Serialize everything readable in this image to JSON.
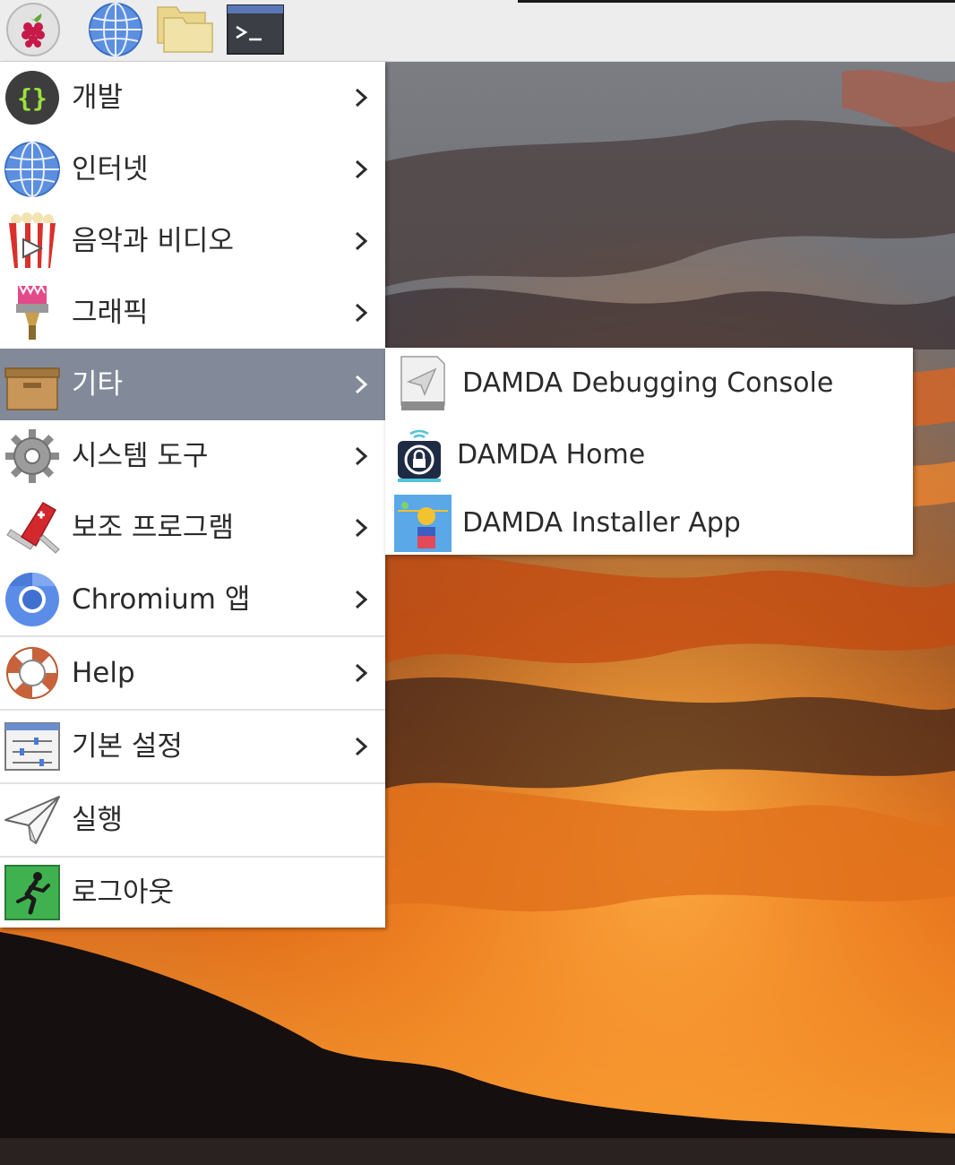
{
  "taskbar": {
    "buttons": [
      {
        "id": "menu",
        "icon": "raspberry-icon"
      },
      {
        "id": "web-browser",
        "icon": "globe-icon"
      },
      {
        "id": "file-manager",
        "icon": "folder-icon"
      },
      {
        "id": "terminal",
        "icon": "terminal-icon",
        "glyph": ">_"
      }
    ]
  },
  "menu": {
    "items": [
      {
        "label": "개발",
        "icon": "braces-icon",
        "has_submenu": true
      },
      {
        "label": "인터넷",
        "icon": "globe-icon",
        "has_submenu": true
      },
      {
        "label": "음악과 비디오",
        "icon": "popcorn-icon",
        "has_submenu": true
      },
      {
        "label": "그래픽",
        "icon": "paintbrush-icon",
        "has_submenu": true
      },
      {
        "label": "기타",
        "icon": "archive-box-icon",
        "has_submenu": true,
        "active": true
      },
      {
        "label": "시스템 도구",
        "icon": "gear-icon",
        "has_submenu": true
      },
      {
        "label": "보조 프로그램",
        "icon": "swiss-knife-icon",
        "has_submenu": true
      },
      {
        "label": "Chromium 앱",
        "icon": "chromium-icon",
        "has_submenu": true
      },
      {
        "label": "Help",
        "icon": "lifebuoy-icon",
        "has_submenu": true
      },
      {
        "label": "기본 설정",
        "icon": "preferences-icon",
        "has_submenu": true
      },
      {
        "label": "실행",
        "icon": "paper-plane-icon",
        "has_submenu": false
      },
      {
        "label": "로그아웃",
        "icon": "exit-icon",
        "has_submenu": false
      }
    ]
  },
  "submenu": {
    "parent": "기타",
    "items": [
      {
        "label": "DAMDA Debugging Console",
        "icon": "debug-console-icon"
      },
      {
        "label": "DAMDA Home",
        "icon": "damda-home-icon"
      },
      {
        "label": "DAMDA Installer App",
        "icon": "damda-installer-icon"
      }
    ]
  },
  "colors": {
    "menu_active_bg": "#828a99",
    "menu_bg": "#ffffff",
    "text": "#2b2b2b",
    "taskbar_bg": "#ededed"
  }
}
